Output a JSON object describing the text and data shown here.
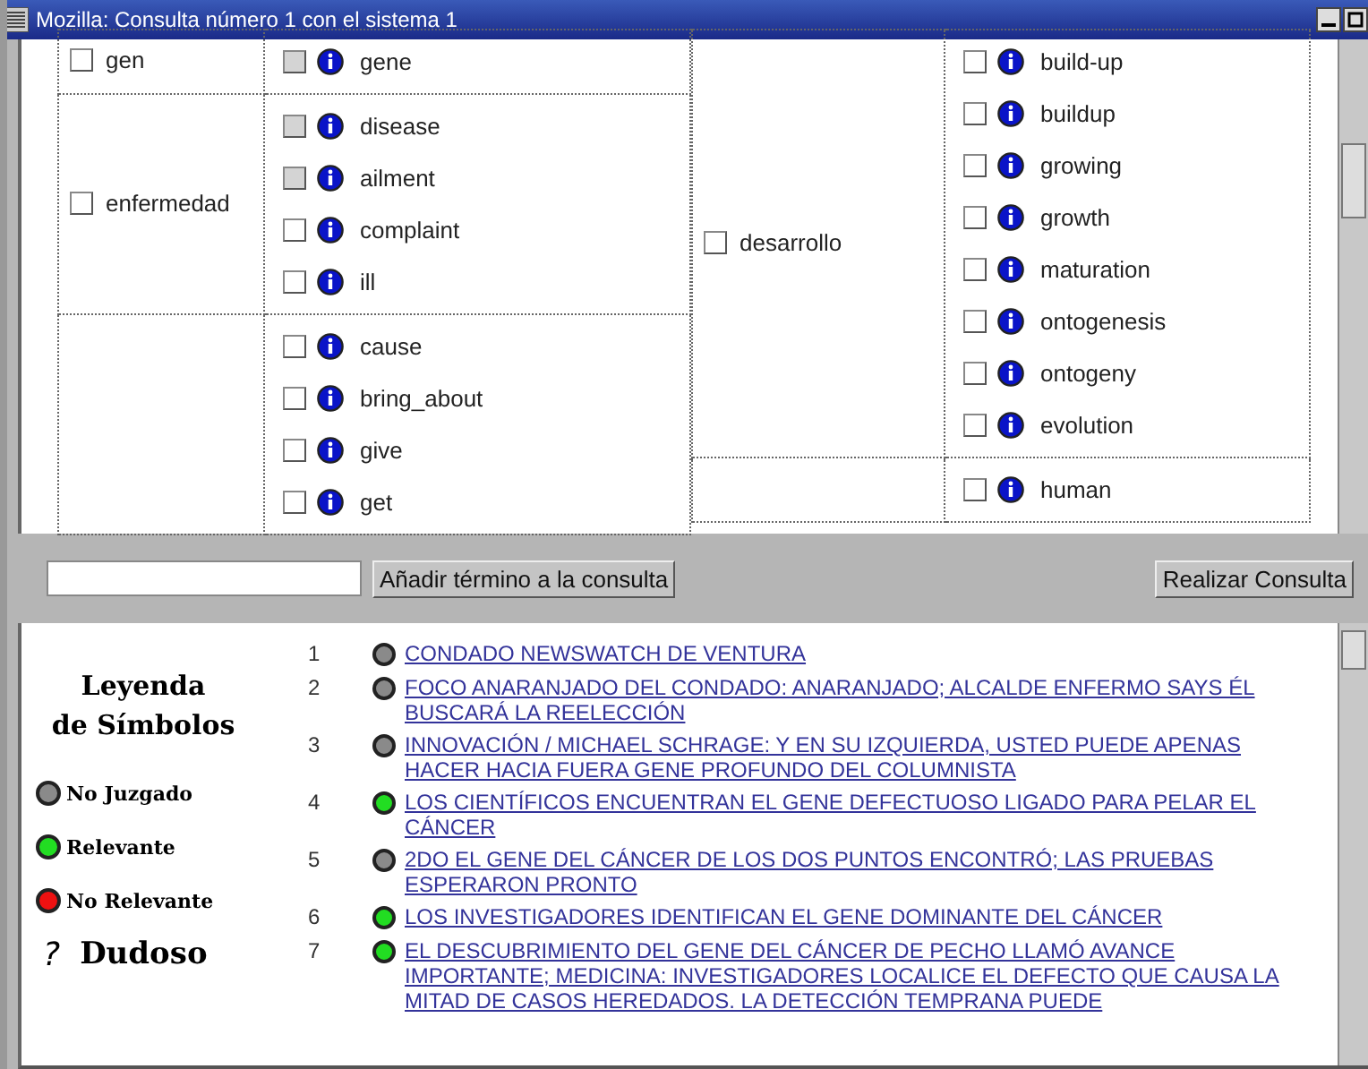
{
  "window": {
    "title": "Mozilla: Consulta número 1 con el sistema 1"
  },
  "term_tables": [
    [
      {
        "term": {
          "label": "gen",
          "checked": false
        },
        "synonyms": [
          {
            "label": "gene",
            "checked": false,
            "disabled": true
          }
        ]
      },
      {
        "term": {
          "label": "enfermedad",
          "checked": false
        },
        "synonyms": [
          {
            "label": "disease",
            "checked": false,
            "disabled": true
          },
          {
            "label": "ailment",
            "checked": false,
            "disabled": true
          },
          {
            "label": "complaint",
            "checked": false,
            "disabled": false
          },
          {
            "label": "ill",
            "checked": false,
            "disabled": false
          }
        ]
      },
      {
        "synonyms": [
          {
            "label": "cause",
            "checked": false,
            "disabled": false
          },
          {
            "label": "bring_about",
            "checked": false,
            "disabled": false
          },
          {
            "label": "give",
            "checked": false,
            "disabled": false
          },
          {
            "label": "get",
            "checked": false,
            "disabled": false
          }
        ]
      }
    ],
    [
      {
        "term": {
          "label": "desarrollo",
          "checked": false
        },
        "synonyms": [
          {
            "label": "build-up",
            "checked": false,
            "disabled": false
          },
          {
            "label": "buildup",
            "checked": false,
            "disabled": false
          },
          {
            "label": "growing",
            "checked": false,
            "disabled": false
          },
          {
            "label": "growth",
            "checked": false,
            "disabled": false
          },
          {
            "label": "maturation",
            "checked": false,
            "disabled": false
          },
          {
            "label": "ontogenesis",
            "checked": false,
            "disabled": false
          },
          {
            "label": "ontogeny",
            "checked": false,
            "disabled": false
          },
          {
            "label": "evolution",
            "checked": false,
            "disabled": false
          }
        ]
      },
      {
        "synonyms": [
          {
            "label": "human",
            "checked": false,
            "disabled": false
          }
        ]
      }
    ]
  ],
  "query_bar": {
    "add_button": "Añadir término a la consulta",
    "run_button": "Realizar Consulta"
  },
  "legend": {
    "title": "Leyenda\nde Símbolos",
    "items": [
      {
        "label": "No Juzgado",
        "kind": "dot",
        "color": "#8a8a8a"
      },
      {
        "label": "Relevante",
        "kind": "dot",
        "color": "#22dd22"
      },
      {
        "label": "No Relevante",
        "kind": "dot",
        "color": "#ee1111"
      },
      {
        "label": "Dudoso",
        "kind": "question",
        "symbol": "?"
      }
    ]
  },
  "results": [
    {
      "number": "1",
      "color": "#8a8a8a",
      "title": "CONDADO NEWSWATCH DE VENTURA"
    },
    {
      "number": "2",
      "color": "#8a8a8a",
      "title": "FOCO ANARANJADO DEL CONDADO: ANARANJADO; ALCALDE ENFERMO SAYS ÉL BUSCARÁ LA REELECCIÓN"
    },
    {
      "number": "3",
      "color": "#8a8a8a",
      "title": "INNOVACIÓN / MICHAEL SCHRAGE: Y EN SU IZQUIERDA, USTED PUEDE APENAS HACER HACIA FUERA GENE PROFUNDO DEL COLUMNISTA"
    },
    {
      "number": "4",
      "color": "#22dd22",
      "title": "LOS CIENTÍFICOS ENCUENTRAN EL GENE DEFECTUOSO LIGADO PARA PELAR EL CÁNCER"
    },
    {
      "number": "5",
      "color": "#8a8a8a",
      "title": "2DO EL GENE DEL CÁNCER DE LOS DOS PUNTOS ENCONTRÓ; LAS PRUEBAS ESPERARON PRONTO"
    },
    {
      "number": "6",
      "color": "#22dd22",
      "title": "LOS INVESTIGADORES IDENTIFICAN EL GENE DOMINANTE DEL CÁNCER"
    },
    {
      "number": "7",
      "color": "#22dd22",
      "title": "EL DESCUBRIMIENTO DEL GENE DEL CÁNCER DE PECHO LLAMÓ AVANCE IMPORTANTE; MEDICINA: INVESTIGADORES LOCALICE EL DEFECTO QUE CAUSA LA MITAD DE CASOS HEREDADOS. LA DETECCIÓN TEMPRANA PUEDE"
    }
  ]
}
